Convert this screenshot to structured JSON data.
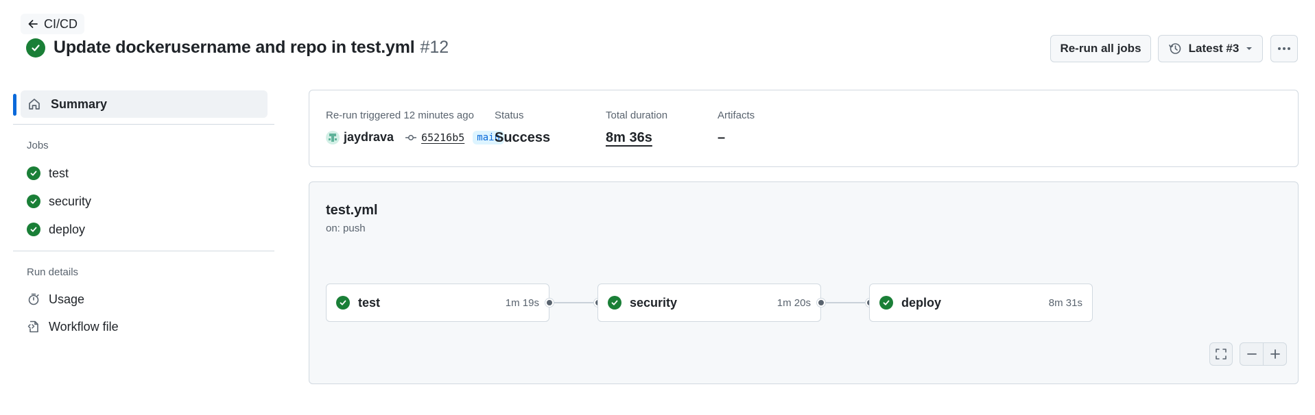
{
  "header": {
    "back_label": "CI/CD",
    "title": "Update dockerusername and repo in test.yml",
    "run_number": "#12",
    "rerun_label": "Re-run all jobs",
    "attempt_label": "Latest #3"
  },
  "sidebar": {
    "summary_label": "Summary",
    "jobs_heading": "Jobs",
    "jobs": [
      {
        "label": "test"
      },
      {
        "label": "security"
      },
      {
        "label": "deploy"
      }
    ],
    "run_details_heading": "Run details",
    "details": [
      {
        "label": "Usage",
        "icon": "stopwatch-icon"
      },
      {
        "label": "Workflow file",
        "icon": "file-code-icon"
      }
    ]
  },
  "summary": {
    "trigger_label": "Re-run triggered 12 minutes ago",
    "actor": "jaydrava",
    "commit": "65216b5",
    "branch": "main",
    "status_label": "Status",
    "status_value": "Success",
    "duration_label": "Total duration",
    "duration_value": "8m 36s",
    "artifacts_label": "Artifacts",
    "artifacts_value": "–"
  },
  "workflow": {
    "file": "test.yml",
    "trigger": "on: push",
    "jobs": [
      {
        "name": "test",
        "duration": "1m 19s"
      },
      {
        "name": "security",
        "duration": "1m 20s"
      },
      {
        "name": "deploy",
        "duration": "8m 31s"
      }
    ]
  },
  "colors": {
    "success": "#1a7f37",
    "accent": "#0969da",
    "muted_text": "#59636e",
    "border": "#d1d9e0"
  }
}
